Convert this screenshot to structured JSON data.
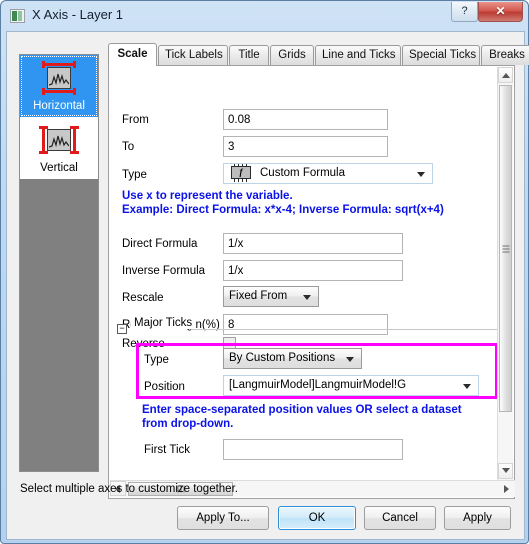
{
  "window": {
    "title": "X Axis - Layer 1",
    "icon": "axis-dialog-icon",
    "help_label": "?",
    "close_label": "✕"
  },
  "axis_list": {
    "items": [
      {
        "label": "Horizontal",
        "selected": true,
        "icon": "horizontal-axis-icon"
      },
      {
        "label": "Vertical",
        "selected": false,
        "icon": "vertical-axis-icon"
      }
    ]
  },
  "tabs": [
    {
      "label": "Scale",
      "active": true
    },
    {
      "label": "Tick Labels",
      "active": false
    },
    {
      "label": "Title",
      "active": false
    },
    {
      "label": "Grids",
      "active": false
    },
    {
      "label": "Line and Ticks",
      "active": false
    },
    {
      "label": "Special Ticks",
      "active": false
    },
    {
      "label": "Breaks",
      "active": false
    }
  ],
  "scale": {
    "from_label": "From",
    "from_value": "0.08",
    "to_label": "To",
    "to_value": "3",
    "type_label": "Type",
    "type_value": "Custom Formula",
    "type_icon": "formula-chip-icon",
    "hint_line1": "Use x to represent the variable.",
    "hint_line2": "Example: Direct Formula: x*x-4; Inverse Formula: sqrt(x+4)",
    "direct_formula_label": "Direct Formula",
    "direct_formula_value": "1/x",
    "inverse_formula_label": "Inverse Formula",
    "inverse_formula_value": "1/x",
    "rescale_label": "Rescale",
    "rescale_value": "Fixed From",
    "rescale_margin_label": "Rescale Margin(%)",
    "rescale_margin_value": "8",
    "reverse_label": "Reverse",
    "reverse_checked": false
  },
  "major_ticks": {
    "group_label": "Major Ticks",
    "group_toggle": "−",
    "type_label": "Type",
    "type_value": "By Custom Positions",
    "position_label": "Position",
    "position_value": "[LangmuirModel]LangmuirModel!G",
    "hint_line1": "Enter space-separated position values OR select a dataset",
    "hint_line2": "from drop-down.",
    "first_tick_label": "First Tick",
    "first_tick_value": "",
    "highlight_color": "#ff00ff"
  },
  "footer": {
    "status_text": "Select multiple axes to customize together.",
    "buttons": [
      {
        "label": "Apply To...",
        "default": false
      },
      {
        "label": "OK",
        "default": true
      },
      {
        "label": "Cancel",
        "default": false
      },
      {
        "label": "Apply",
        "default": false
      }
    ]
  }
}
